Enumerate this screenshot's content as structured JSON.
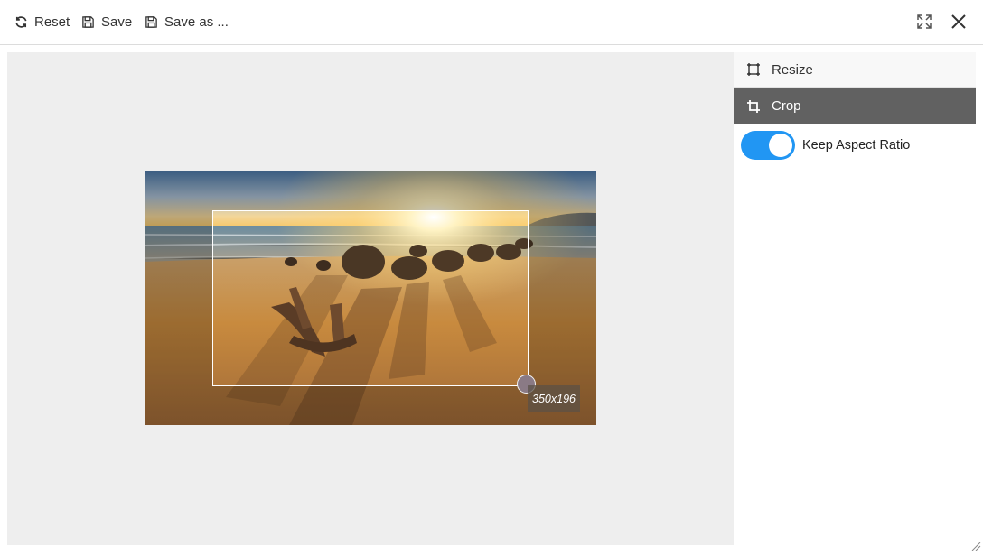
{
  "toolbar": {
    "reset_label": "Reset",
    "save_label": "Save",
    "save_as_label": "Save as ..."
  },
  "window_controls": [
    "expand-icon",
    "close-icon"
  ],
  "editor": {
    "crop_size_label": "350x196"
  },
  "panel": {
    "items": [
      {
        "label": "Resize",
        "icon": "resize-icon",
        "active": false
      },
      {
        "label": "Crop",
        "icon": "crop-icon",
        "active": true
      }
    ],
    "keep_aspect_ratio_label": "Keep Aspect Ratio",
    "keep_aspect_ratio_on": true
  },
  "colors": {
    "accent": "#2196f3",
    "active_item_bg": "#616161",
    "canvas_bg": "#eeeeee"
  }
}
